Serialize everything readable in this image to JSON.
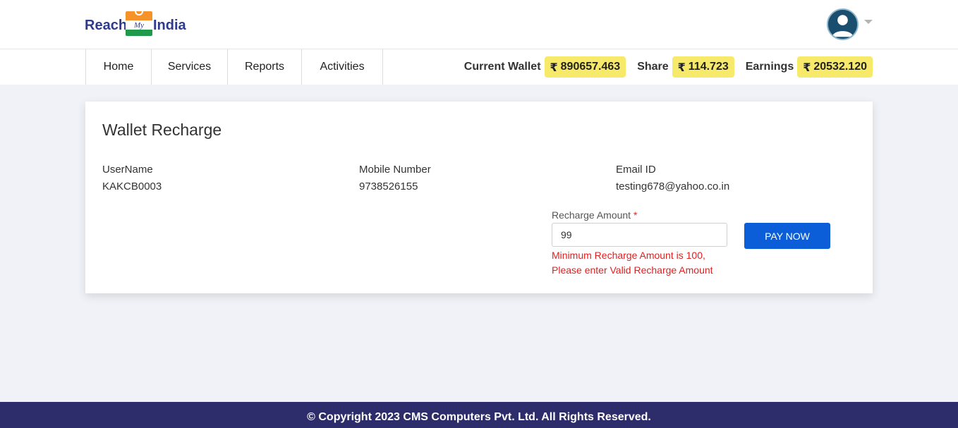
{
  "brand": {
    "left": "Reach",
    "middle": "My",
    "right": "India",
    "colors": {
      "blue": "#2e3a8c",
      "orange": "#f5922a",
      "green": "#1e9a4a"
    }
  },
  "header": {
    "avatar_icon": "user-avatar-icon",
    "dropdown_icon": "chevron-down-icon"
  },
  "nav": {
    "items": [
      {
        "label": "Home"
      },
      {
        "label": "Services"
      },
      {
        "label": "Reports"
      },
      {
        "label": "Activities"
      }
    ]
  },
  "wallets": {
    "currency_symbol": "₹",
    "current_wallet_label": "Current Wallet",
    "current_wallet_value": "890657.463",
    "share_label": "Share",
    "share_value": "114.723",
    "earnings_label": "Earnings",
    "earnings_value": "20532.120",
    "pill_color": "#f7e96a"
  },
  "card": {
    "title": "Wallet Recharge",
    "username_label": "UserName",
    "username_value": "KAKCB0003",
    "mobile_label": "Mobile Number",
    "mobile_value": "9738526155",
    "email_label": "Email ID",
    "email_value": "testing678@yahoo.co.in",
    "amount_label": "Recharge Amount",
    "amount_required_marker": "*",
    "amount_value": "99",
    "error_line1": "Minimum Recharge Amount is 100,",
    "error_line2": "Please enter Valid Recharge Amount",
    "pay_button_label": "PAY NOW",
    "button_color": "#0b5ed7",
    "error_color": "#e02020"
  },
  "footer": {
    "text": "© Copyright 2023 CMS Computers Pvt. Ltd. All Rights Reserved.",
    "background": "#2d2d6b"
  }
}
